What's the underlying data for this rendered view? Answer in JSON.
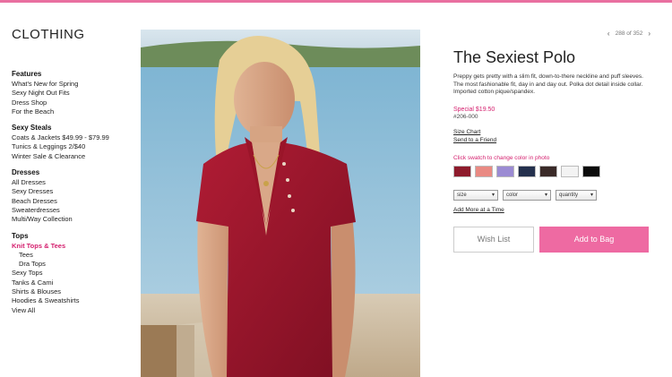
{
  "category": "CLOTHING",
  "sidebar": {
    "sections": [
      {
        "title": "Features",
        "items": [
          {
            "label": "What's New for Spring",
            "active": false,
            "sub": false
          },
          {
            "label": "Sexy Night Out Fits",
            "active": false,
            "sub": false
          },
          {
            "label": "Dress Shop",
            "active": false,
            "sub": false
          },
          {
            "label": "For the Beach",
            "active": false,
            "sub": false
          }
        ]
      },
      {
        "title": "Sexy Steals",
        "items": [
          {
            "label": "Coats & Jackets $49.99 - $79.99",
            "active": false,
            "sub": false
          },
          {
            "label": "Tunics & Leggings 2/$40",
            "active": false,
            "sub": false
          },
          {
            "label": "Winter Sale & Clearance",
            "active": false,
            "sub": false
          }
        ]
      },
      {
        "title": "Dresses",
        "items": [
          {
            "label": "All Dresses",
            "active": false,
            "sub": false
          },
          {
            "label": "Sexy Dresses",
            "active": false,
            "sub": false
          },
          {
            "label": "Beach Dresses",
            "active": false,
            "sub": false
          },
          {
            "label": "Sweaterdresses",
            "active": false,
            "sub": false
          },
          {
            "label": "Multi/Way Collection",
            "active": false,
            "sub": false
          }
        ]
      },
      {
        "title": "Tops",
        "items": [
          {
            "label": "Knit Tops & Tees",
            "active": true,
            "sub": false
          },
          {
            "label": "Tees",
            "active": false,
            "sub": true
          },
          {
            "label": "Dra Tops",
            "active": false,
            "sub": true
          },
          {
            "label": "Sexy Tops",
            "active": false,
            "sub": false
          },
          {
            "label": "Tanks & Cami",
            "active": false,
            "sub": false
          },
          {
            "label": "Shirts & Blouses",
            "active": false,
            "sub": false
          },
          {
            "label": "Hoodies & Sweatshirts",
            "active": false,
            "sub": false
          },
          {
            "label": "View All",
            "active": false,
            "sub": false
          }
        ]
      }
    ]
  },
  "pager": {
    "prev_icon": "chevron-left",
    "next_icon": "chevron-right",
    "text": "288 of 352"
  },
  "product": {
    "title": "The Sexiest Polo",
    "description": "Preppy gets pretty with a slim fit, down-to-there neckline and puff sleeves. The most fashionable fit, day in and day out. Polka dot detail inside collar. Imported cotton pique/spandex.",
    "price": "Special $19.50",
    "sku": "#206-000",
    "size_chart": "Size Chart",
    "send_friend": "Send to a Friend",
    "swatch_hint": "Click swatch to change color in photo",
    "swatches": [
      "#8e1b2c",
      "#e98a83",
      "#9b8bd3",
      "#24304d",
      "#3a2a28",
      "#f3f3f3",
      "#0b0b0b"
    ],
    "selects": {
      "size": "size",
      "color": "color",
      "quantity": "quantity"
    },
    "add_more": "Add More at a Time",
    "wish_list": "Wish List",
    "add_to_bag": "Add to Bag"
  },
  "colors": {
    "accent": "#d4206e",
    "button": "#ee6aa2",
    "topbar": "#e96fa0"
  }
}
